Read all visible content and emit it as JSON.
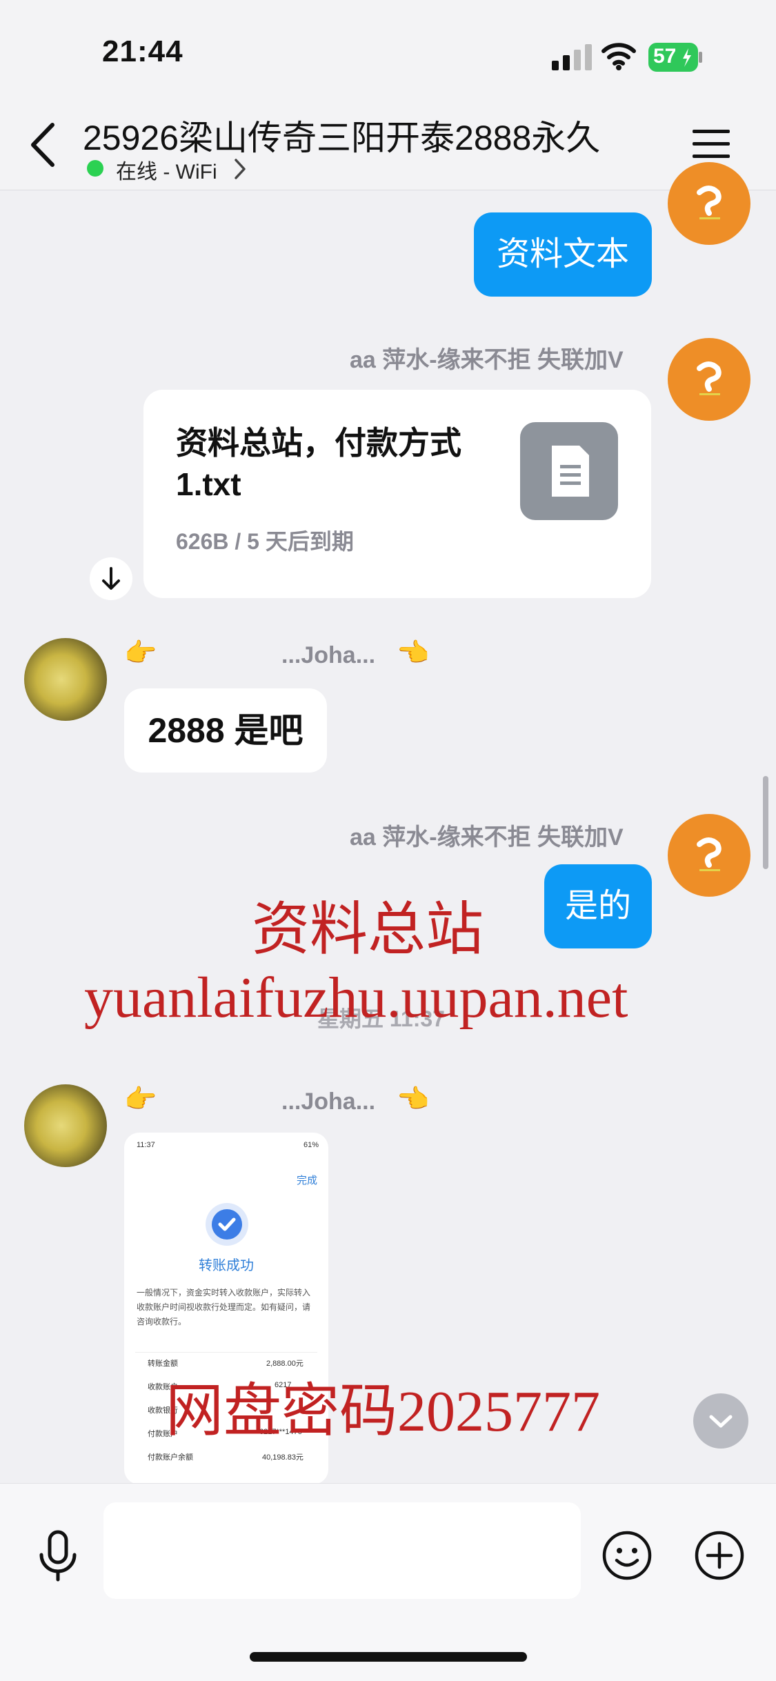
{
  "status_bar": {
    "time": "21:44",
    "battery": "57"
  },
  "header": {
    "title": "25926梁山传奇三阳开泰2888永久",
    "status": "在线 - WiFi"
  },
  "messages": {
    "m1": {
      "text": "资料文本"
    },
    "m2": {
      "nick": "aa 萍水-缘来不拒 失联加V",
      "file_name": "资料总站，付款方式1.txt",
      "file_meta": "626B / 5 天后到期"
    },
    "m3": {
      "nick": "...Joha...",
      "emoji_left": "👉",
      "emoji_right": "👈",
      "text": "2888 是吧"
    },
    "m4": {
      "nick": "aa 萍水-缘来不拒 失联加V",
      "text": "是的"
    },
    "time_divider": "星期五 11:37",
    "m5": {
      "nick": "...Joha...",
      "emoji_left": "👉",
      "emoji_right": "👈",
      "screenshot": {
        "status_time": "11:37",
        "battery": "61%",
        "done": "完成",
        "success": "转账成功",
        "note": "一般情况下，资金实时转入收款账户，实际转入收款账户时间视收款行处理而定。如有疑问，请咨询收款行。",
        "rows": [
          {
            "label": "转账金额",
            "value": "2,888.00元"
          },
          {
            "label": "收款账户",
            "value": "6217"
          },
          {
            "label": "收款银行",
            "value": ""
          },
          {
            "label": "付款账户",
            "value": "6217***1476"
          },
          {
            "label": "付款账户余额",
            "value": "40,198.83元"
          }
        ]
      }
    }
  },
  "watermark": {
    "line1": "资料总站",
    "line2": "yuanlaifuzhu.uupan.net",
    "line3": "网盘密码2025777"
  },
  "input": {
    "placeholder": ""
  },
  "colors": {
    "accent": "#0d9af5",
    "online": "#2bd152",
    "avatar": "#ee8e27",
    "watermark": "#c12222"
  }
}
